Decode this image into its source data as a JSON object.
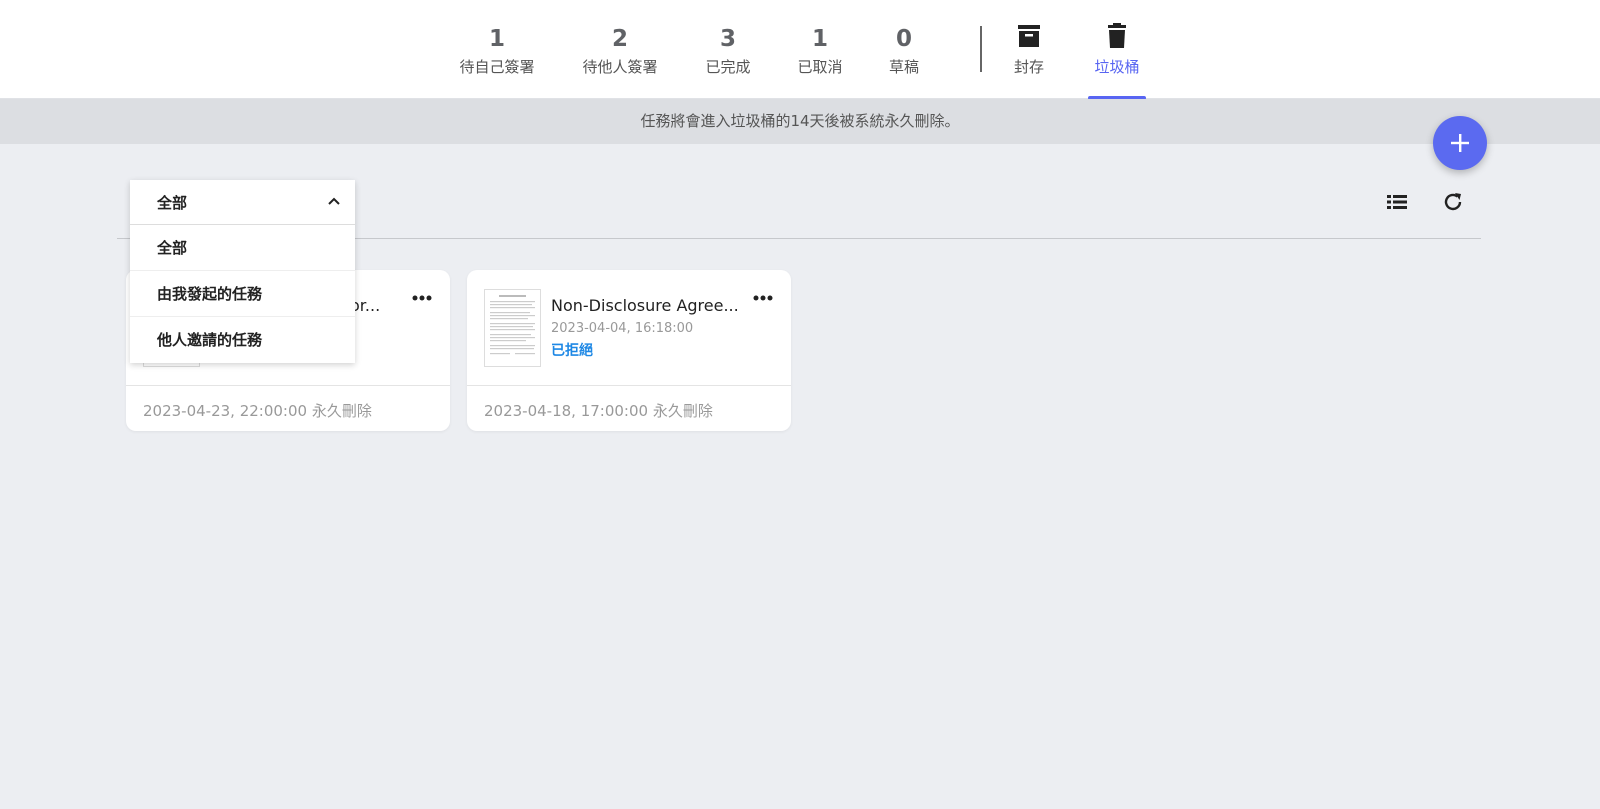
{
  "tabs": {
    "stats": [
      {
        "count": "1",
        "label": "待自己簽署"
      },
      {
        "count": "2",
        "label": "待他人簽署"
      },
      {
        "count": "3",
        "label": "已完成"
      },
      {
        "count": "1",
        "label": "已取消"
      },
      {
        "count": "0",
        "label": "草稿"
      }
    ],
    "archive": {
      "label": "封存",
      "icon": "archive-icon"
    },
    "trash": {
      "label": "垃圾桶",
      "icon": "trash-icon",
      "active": true
    }
  },
  "notice": "任務將會進入垃圾桶的14天後被系統永久刪除。",
  "accent_color": "#5865f2",
  "filter": {
    "selected": "全部",
    "options": [
      "全部",
      "由我發起的任務",
      "他人邀請的任務"
    ]
  },
  "cards": [
    {
      "title": "...or...",
      "title_visible": "or...",
      "footer": "2023-04-23, 22:00:00 永久刪除"
    },
    {
      "title": "Non-Disclosure Agree...",
      "date": "2023-04-04, 16:18:00",
      "status": "已拒絕",
      "footer": "2023-04-18, 17:00:00 永久刪除"
    }
  ]
}
